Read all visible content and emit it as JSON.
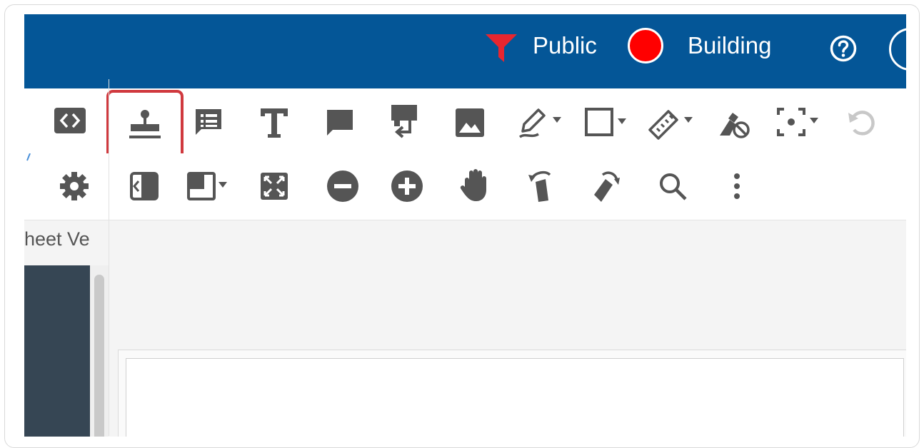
{
  "header": {
    "filter_label": "Public",
    "status_label": "Building",
    "status_color": "#ff0000",
    "accent_color": "#045697",
    "filter_color": "#e8262f"
  },
  "toolbar_row1": [
    {
      "icon": "code-panel-icon"
    },
    {
      "icon": "stamp-icon",
      "selected": true
    },
    {
      "icon": "note-list-icon"
    },
    {
      "icon": "text-icon"
    },
    {
      "icon": "comment-icon"
    },
    {
      "icon": "callout-icon"
    },
    {
      "icon": "image-icon"
    },
    {
      "icon": "pen-icon"
    },
    {
      "icon": "rectangle-icon"
    },
    {
      "icon": "ruler-icon"
    },
    {
      "icon": "eraser-icon"
    },
    {
      "icon": "snapshot-icon"
    },
    {
      "icon": "undo-icon"
    }
  ],
  "toolbar_row2": [
    {
      "icon": "gear-icon"
    },
    {
      "icon": "collapse-panel-icon"
    },
    {
      "icon": "layout-icon"
    },
    {
      "icon": "fit-screen-icon"
    },
    {
      "icon": "zoom-out-icon"
    },
    {
      "icon": "zoom-in-icon"
    },
    {
      "icon": "pan-hand-icon"
    },
    {
      "icon": "rotate-left-icon"
    },
    {
      "icon": "rotate-right-icon"
    },
    {
      "icon": "search-icon"
    },
    {
      "icon": "more-vertical-icon"
    }
  ],
  "sidebar": {
    "label": "heet Ve"
  }
}
